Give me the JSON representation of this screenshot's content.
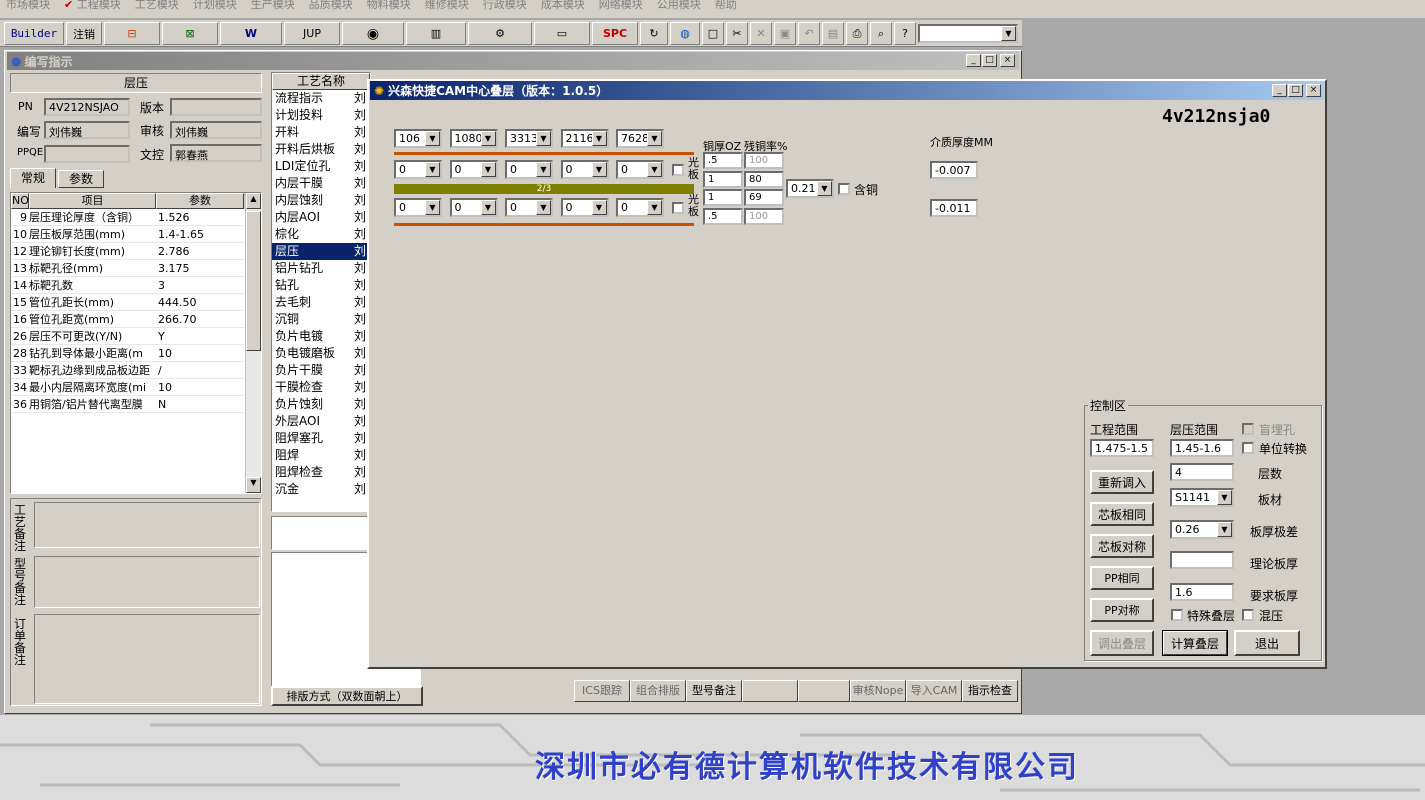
{
  "menu": [
    "市场模块",
    "工程模块",
    "工艺模块",
    "计划模块",
    "生产模块",
    "品质模块",
    "物料模块",
    "维修模块",
    "行政模块",
    "成本模块",
    "网络模块",
    "公用模块",
    "帮助"
  ],
  "toolbar": {
    "builder": "Builder",
    "logout": "注销",
    "jup": "JUP",
    "spc": "SPC"
  },
  "bg_company": "深圳市必有德计算机软件技术有限公司",
  "editor": {
    "title": "编写指示",
    "section": "层压",
    "pn_label": "PN",
    "pn_value": "4V212NSJAO",
    "version_label": "版本",
    "version_value": "",
    "writer_label": "编写",
    "writer_value": "刘伟巍",
    "reviewer_label": "审核",
    "reviewer_value": "刘伟巍",
    "ppqe_label": "PPQE",
    "ppqe_value": "",
    "doc_label": "文控",
    "doc_value": "郭春燕",
    "tabs": [
      "常规",
      "参数"
    ],
    "table_headers": [
      "NO",
      "项目",
      "参数"
    ],
    "rows": [
      {
        "no": "9",
        "item": "层压理论厚度（含铜）",
        "val": "1.526"
      },
      {
        "no": "10",
        "item": "层压板厚范围(mm)",
        "val": "1.4-1.65"
      },
      {
        "no": "12",
        "item": "理论铆钉长度(mm)",
        "val": "2.786"
      },
      {
        "no": "13",
        "item": "标靶孔径(mm)",
        "val": "3.175"
      },
      {
        "no": "14",
        "item": "标靶孔数",
        "val": "3"
      },
      {
        "no": "15",
        "item": "管位孔距长(mm)",
        "val": "444.50"
      },
      {
        "no": "16",
        "item": "管位孔距宽(mm)",
        "val": "266.70"
      },
      {
        "no": "26",
        "item": "层压不可更改(Y/N)",
        "val": "Y"
      },
      {
        "no": "28",
        "item": "钻孔到导体最小距离(m",
        "val": "10"
      },
      {
        "no": "33",
        "item": "靶标孔边缘到成品板边距",
        "val": "/"
      },
      {
        "no": "34",
        "item": "最小内层隔离环宽度(mi",
        "val": "10"
      },
      {
        "no": "36",
        "item": "用铜箔/铝片替代离型膜",
        "val": "N"
      }
    ],
    "notes": [
      "工艺备注",
      "型号备注",
      "订单备注"
    ],
    "process_header": "工艺名称",
    "processes": [
      "流程指示",
      "计划投料",
      "开料",
      "开料后烘板",
      "LDI定位孔",
      "内层干膜",
      "内层蚀刻",
      "内层AOI",
      "棕化",
      "层压",
      "铝片钻孔",
      "钻孔",
      "去毛刺",
      "沉铜",
      "负片电镀",
      "负电镀磨板",
      "负片干膜",
      "干膜检查",
      "负片蚀刻",
      "外层AOI",
      "阻焊塞孔",
      "阻焊",
      "阻焊检查",
      "沉金"
    ],
    "process_col2": "刘",
    "sort_label": "排版方式（双数面朝上）",
    "bottom_buttons": [
      "ICS跟踪",
      "组合排版",
      "型号备注",
      "",
      "",
      "审核Nope",
      "导入CAM",
      "指示检查"
    ]
  },
  "stack": {
    "title": "兴森快捷CAM中心叠层（版本：1.0.5）",
    "part": "4v212nsja0",
    "pp_top": [
      "106",
      "1080",
      "3313",
      "2116",
      "7628"
    ],
    "pp_row1": [
      "0",
      "0",
      "0",
      "0",
      "0"
    ],
    "pp_row2": [
      "0",
      "0",
      "0",
      "0",
      "0"
    ],
    "core_label": "2/3",
    "guangban": "光板",
    "cu_header": "铜厚OZ",
    "res_header": "残铜率%",
    "cu": [
      ".5",
      "1",
      "1",
      ".5"
    ],
    "res": [
      "100",
      "80",
      "69",
      "100"
    ],
    "core_thk": "0.21",
    "hantong": "含铜",
    "dielectric_label": "介质厚度MM",
    "dielectric": [
      "-0.007",
      "-0.011"
    ],
    "ctrl": {
      "title": "控制区",
      "proj_range_label": "工程范围",
      "proj_range": "1.475-1.5",
      "lam_range_label": "层压范围",
      "lam_range": "1.45-1.6",
      "blind_label": "盲埋孔",
      "unit_label": "单位转换",
      "layers_label": "层数",
      "layers": "4",
      "material_label": "板材",
      "material": "S1141",
      "tol_label": "板厚极差",
      "tol": "0.26",
      "theory_label": "理论板厚",
      "theory": "",
      "req_label": "要求板厚",
      "req": "1.6",
      "special_label": "特殊叠层",
      "mix_label": "混压",
      "btn_reload": "重新调入",
      "btn_core_same": "芯板相同",
      "btn_core_sym": "芯板对称",
      "btn_pp_same": "PP相同",
      "btn_pp_sym": "PP对称",
      "btn_export": "调出叠层",
      "btn_calc": "计算叠层",
      "btn_exit": "退出"
    }
  }
}
